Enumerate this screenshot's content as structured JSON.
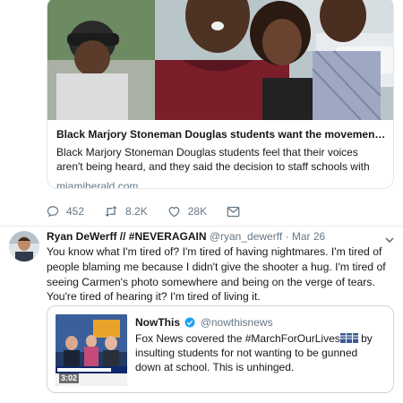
{
  "link_card": {
    "title": "Black Marjory Stoneman Douglas students want the movement to inc...",
    "description": "Black Marjory Stoneman Douglas students feel that their voices aren't being heard, and they said the decision to staff schools with more police officers ...",
    "domain": "miamiherald.com",
    "image_icon": "news-photo-students"
  },
  "actions": {
    "reply_count": "452",
    "retweet_count": "8.2K",
    "like_count": "28K",
    "reply_icon": "reply-icon",
    "retweet_icon": "retweet-icon",
    "like_icon": "heart-icon",
    "message_icon": "envelope-icon"
  },
  "tweet": {
    "author_name": "Ryan DeWerff // #NEVERAGAIN",
    "author_handle": "@ryan_dewerff",
    "separator": "·",
    "time": "Mar 26",
    "text": "You know what I'm tired of? I'm tired of having nightmares. I'm tired of people blaming me because I didn't give the shooter a hug. I'm tired of seeing Carmen's photo somewhere and being on the verge of tears. You're tired of hearing it? I'm tired of living it."
  },
  "quote": {
    "name": "NowThis",
    "handle": "@nowthisnews",
    "text_before_flags": "Fox News covered the #MarchForOurLives",
    "text_after_flags": " by insulting students for not wanting to be gunned down at school. This is unhinged.",
    "video_duration": "3:02"
  },
  "colors": {
    "text": "#14171a",
    "secondary": "#657786",
    "border": "#e1e8ed",
    "verified": "#1da1f2"
  }
}
